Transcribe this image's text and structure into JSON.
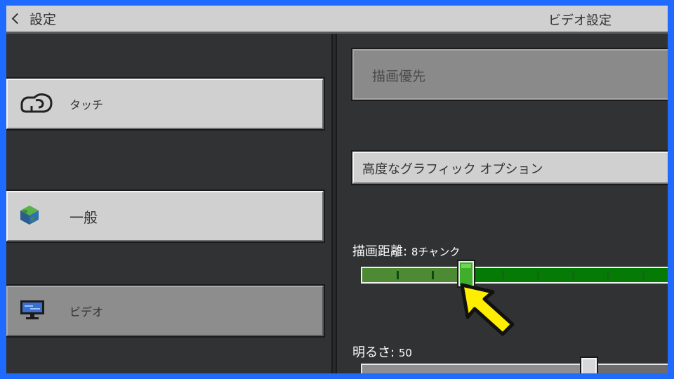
{
  "header": {
    "back_label": "設定",
    "title": "ビデオ設定"
  },
  "sidebar": {
    "items": [
      {
        "label": "タッチ",
        "icon": "touch-hand-icon",
        "selected": false
      },
      {
        "label": "一般",
        "icon": "globe-icon",
        "selected": false
      },
      {
        "label": "ビデオ",
        "icon": "monitor-icon",
        "selected": true
      }
    ],
    "section_label": "一般"
  },
  "main": {
    "graphics_mode_value": "描画優先",
    "advanced_graphics_label": "高度なグラフィック オプション",
    "render_distance": {
      "label": "描画距離:",
      "value_text": "8チャンク",
      "value": 8,
      "min": 2,
      "max": 24
    },
    "brightness": {
      "label": "明るさ:",
      "value_text": "50",
      "value": 50
    }
  },
  "colors": {
    "frame": "#1f6bff",
    "slider_active": "#3fae2a",
    "pointer_arrow": "#ffee00"
  }
}
